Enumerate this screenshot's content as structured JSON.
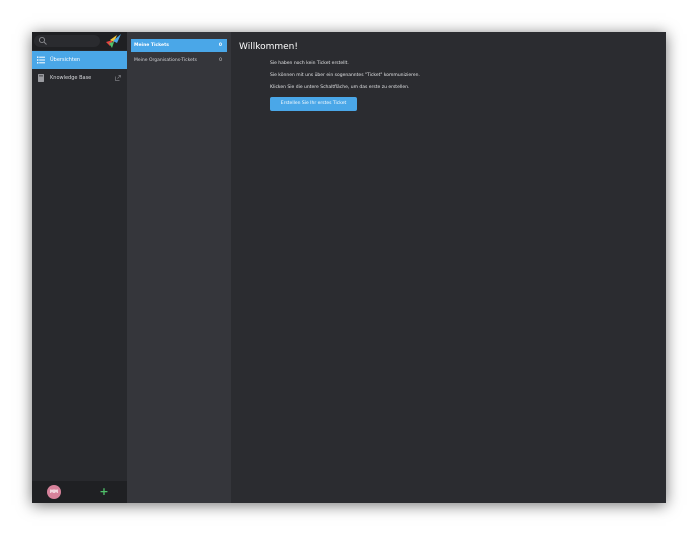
{
  "sidebar": {
    "search": {
      "placeholder": ""
    },
    "items": [
      {
        "label": "Übersichten",
        "icon": "list-icon",
        "active": true
      },
      {
        "label": "Knowledge Base",
        "icon": "book-icon",
        "external": true
      }
    ],
    "user": {
      "initials": "MM",
      "avatar_color": "#d7829b"
    },
    "add_label": "+"
  },
  "overviews": {
    "items": [
      {
        "label": "Meine Tickets",
        "count": "0",
        "active": true
      },
      {
        "label": "Meine Organisations-Tickets",
        "count": "0",
        "active": false
      }
    ]
  },
  "main": {
    "title": "Willkommen!",
    "messages": [
      "Sie haben noch kein Ticket erstellt.",
      "Sie können mit uns über ein sogenanntes \"Ticket\" kommunizieren.",
      "Klicken Sie die untere Schaltfläche, um das erste zu erstellen."
    ],
    "cta_label": "Erstellen Sie Ihr erstes Ticket"
  },
  "colors": {
    "accent": "#4aa7e8",
    "sidebar_bg": "#28292d",
    "overview_bg": "#35363b",
    "content_bg": "#2b2c30",
    "add_green": "#4fc16a"
  }
}
